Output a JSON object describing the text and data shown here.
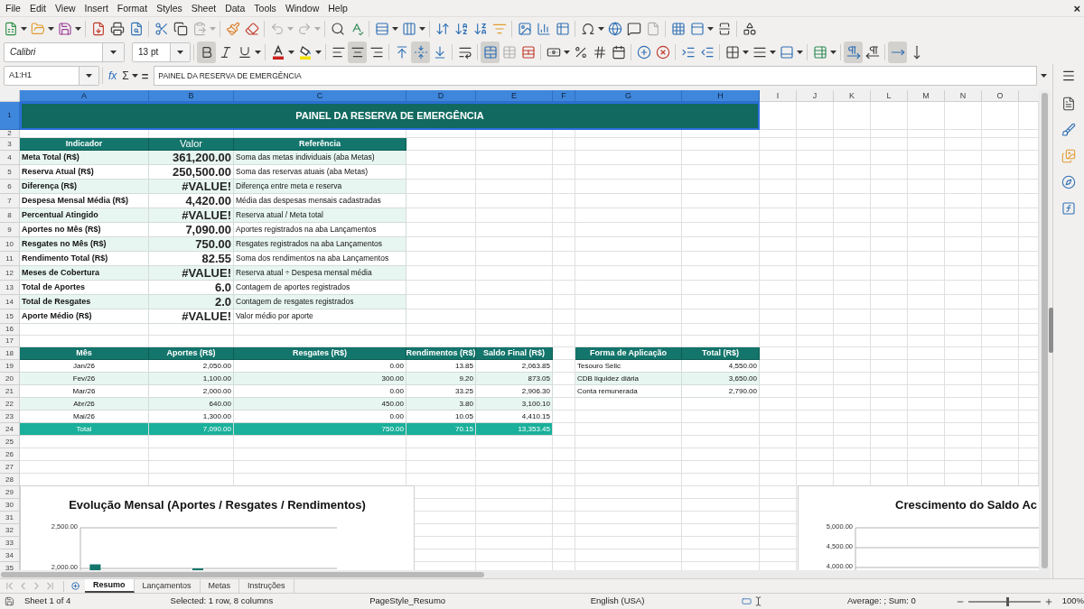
{
  "menu_bar": {
    "items": [
      "File",
      "Edit",
      "View",
      "Insert",
      "Format",
      "Styles",
      "Sheet",
      "Data",
      "Tools",
      "Window",
      "Help"
    ],
    "close": "×"
  },
  "standard_toolbar": {
    "groups": [
      [
        {
          "dropdown": true,
          "disabled": false
        },
        {
          "dropdown": true,
          "disabled": false
        },
        {
          "dropdown": true,
          "disabled": false
        }
      ],
      [
        {
          "dropdown": false,
          "disabled": false
        },
        {
          "dropdown": false,
          "disabled": false
        },
        {
          "dropdown": false,
          "disabled": false
        }
      ],
      [
        {
          "dropdown": false,
          "disabled": false
        },
        {
          "dropdown": false,
          "disabled": false
        },
        {
          "dropdown": true,
          "disabled": true
        }
      ],
      [
        {
          "dropdown": false,
          "disabled": false
        },
        {
          "dropdown": false,
          "disabled": false
        }
      ],
      [
        {
          "dropdown": true,
          "disabled": true
        },
        {
          "dropdown": true,
          "disabled": true
        }
      ],
      [
        {
          "dropdown": false,
          "disabled": false
        },
        {
          "dropdown": false,
          "disabled": false
        }
      ],
      [
        {
          "dropdown": true,
          "disabled": false
        },
        {
          "dropdown": true,
          "disabled": false
        }
      ],
      [
        {
          "dropdown": false,
          "disabled": false
        },
        {
          "dropdown": false,
          "disabled": false
        },
        {
          "dropdown": false,
          "disabled": false
        },
        {
          "dropdown": false,
          "disabled": false
        }
      ],
      [
        {
          "dropdown": false,
          "disabled": false
        },
        {
          "dropdown": false,
          "disabled": false
        },
        {
          "dropdown": false,
          "disabled": false
        }
      ],
      [
        {
          "dropdown": true,
          "disabled": false
        },
        {
          "dropdown": false,
          "disabled": false
        },
        {
          "dropdown": false,
          "disabled": false
        },
        {
          "dropdown": false,
          "disabled": true
        }
      ],
      [
        {
          "dropdown": false,
          "disabled": false
        },
        {
          "dropdown": true,
          "disabled": false
        },
        {
          "dropdown": false,
          "disabled": false
        }
      ],
      [
        {
          "dropdown": false,
          "disabled": false
        }
      ]
    ]
  },
  "formatting_toolbar": {
    "font_name": {
      "value": "Calibri"
    },
    "font_size": {
      "value": "13 pt"
    },
    "groups": [
      [
        {
          "dropdown": false,
          "disabled": false,
          "active": true
        },
        {
          "dropdown": false,
          "disabled": false,
          "active": false
        },
        {
          "dropdown": true,
          "disabled": false,
          "active": false
        }
      ],
      [
        {
          "dropdown": true,
          "disabled": false,
          "active": false
        },
        {
          "dropdown": true,
          "disabled": false,
          "active": false
        }
      ],
      [
        {
          "dropdown": false,
          "disabled": false,
          "active": false
        },
        {
          "dropdown": false,
          "disabled": false,
          "active": true
        },
        {
          "dropdown": false,
          "disabled": false,
          "active": false
        }
      ],
      [
        {
          "dropdown": false,
          "disabled": false,
          "active": false
        },
        {
          "dropdown": false,
          "disabled": false,
          "active": true
        },
        {
          "dropdown": false,
          "disabled": false,
          "active": false
        }
      ],
      [
        {
          "dropdown": false,
          "disabled": false,
          "active": false
        }
      ],
      [
        {
          "dropdown": false,
          "disabled": false,
          "active": true
        },
        {
          "dropdown": false,
          "disabled": true,
          "active": false
        },
        {
          "dropdown": false,
          "disabled": false,
          "active": false
        }
      ],
      [
        {
          "dropdown": true,
          "disabled": false,
          "active": false
        },
        {
          "dropdown": false,
          "disabled": false,
          "active": false
        },
        {
          "dropdown": false,
          "disabled": false,
          "active": false
        },
        {
          "dropdown": false,
          "disabled": false,
          "active": false
        }
      ],
      [
        {
          "dropdown": false,
          "disabled": false,
          "active": false
        },
        {
          "dropdown": false,
          "disabled": false,
          "active": false
        }
      ],
      [
        {
          "dropdown": false,
          "disabled": false,
          "active": false
        },
        {
          "dropdown": false,
          "disabled": false,
          "active": false
        }
      ],
      [
        {
          "dropdown": true,
          "disabled": false,
          "active": false
        },
        {
          "dropdown": true,
          "disabled": false,
          "active": false
        },
        {
          "dropdown": true,
          "disabled": false,
          "active": false
        }
      ],
      [
        {
          "dropdown": true,
          "disabled": false,
          "active": false
        }
      ],
      [
        {
          "dropdown": false,
          "disabled": false,
          "active": true
        },
        {
          "dropdown": false,
          "disabled": false,
          "active": false
        }
      ],
      [
        {
          "dropdown": false,
          "disabled": false,
          "active": true
        },
        {
          "dropdown": false,
          "disabled": false,
          "active": false
        }
      ]
    ]
  },
  "formula_bar": {
    "name_box": {
      "value": "A1:H1"
    },
    "buttons": [
      {
        "label": "fx",
        "dropdown": false
      },
      {
        "label": "Σ",
        "dropdown": true
      },
      {
        "label": "=",
        "dropdown": false
      }
    ],
    "content": {
      "value": "PAINEL DA RESERVA DE EMERGÊNCIA"
    }
  },
  "sheet": {
    "columns": [
      {
        "label": "A",
        "selected": true
      },
      {
        "label": "B",
        "selected": true
      },
      {
        "label": "C",
        "selected": true
      },
      {
        "label": "D",
        "selected": true
      },
      {
        "label": "E",
        "selected": true
      },
      {
        "label": "F",
        "selected": true
      },
      {
        "label": "G",
        "selected": true
      },
      {
        "label": "H",
        "selected": true
      },
      {
        "label": "I",
        "selected": false
      },
      {
        "label": "J",
        "selected": false
      },
      {
        "label": "K",
        "selected": false
      },
      {
        "label": "L",
        "selected": false
      },
      {
        "label": "M",
        "selected": false
      },
      {
        "label": "N",
        "selected": false
      },
      {
        "label": "O",
        "selected": false
      }
    ],
    "rows": [
      {
        "label": "1",
        "selected": true
      },
      {
        "label": "2",
        "selected": false
      },
      {
        "label": "3",
        "selected": false
      },
      {
        "label": "4",
        "selected": false
      },
      {
        "label": "5",
        "selected": false
      },
      {
        "label": "6",
        "selected": false
      },
      {
        "label": "7",
        "selected": false
      },
      {
        "label": "8",
        "selected": false
      },
      {
        "label": "9",
        "selected": false
      },
      {
        "label": "10",
        "selected": false
      },
      {
        "label": "11",
        "selected": false
      },
      {
        "label": "12",
        "selected": false
      },
      {
        "label": "13",
        "selected": false
      },
      {
        "label": "14",
        "selected": false
      },
      {
        "label": "15",
        "selected": false
      },
      {
        "label": "16",
        "selected": false
      },
      {
        "label": "17",
        "selected": false
      },
      {
        "label": "18",
        "selected": false
      },
      {
        "label": "19",
        "selected": false
      },
      {
        "label": "20",
        "selected": false
      },
      {
        "label": "21",
        "selected": false
      },
      {
        "label": "22",
        "selected": false
      },
      {
        "label": "23",
        "selected": false
      },
      {
        "label": "24",
        "selected": false
      },
      {
        "label": "25",
        "selected": false
      },
      {
        "label": "26",
        "selected": false
      },
      {
        "label": "27",
        "selected": false
      },
      {
        "label": "28",
        "selected": false
      },
      {
        "label": "29",
        "selected": false
      },
      {
        "label": "30",
        "selected": false
      },
      {
        "label": "31",
        "selected": false
      },
      {
        "label": "32",
        "selected": false
      },
      {
        "label": "33",
        "selected": false
      },
      {
        "label": "34",
        "selected": false
      },
      {
        "label": "35",
        "selected": false
      }
    ],
    "title_banner": {
      "text": "PAINEL DA RESERVA DE EMERGÊNCIA"
    },
    "indicators_table": {
      "columns": [
        "Indicador",
        "Valor",
        "Referência"
      ],
      "rows": [
        [
          "Meta Total (R$)",
          "361,200.00",
          "Soma das metas individuais (aba Metas)"
        ],
        [
          "Reserva Atual (R$)",
          "250,500.00",
          "Soma das reservas atuais (aba Metas)"
        ],
        [
          "Diferença (R$)",
          "#VALUE!",
          "Diferença entre meta e reserva"
        ],
        [
          "Despesa Mensal Média (R$)",
          "4,420.00",
          "Média das despesas mensais cadastradas"
        ],
        [
          "Percentual Atingido",
          "#VALUE!",
          "Reserva atual / Meta total"
        ],
        [
          "Aportes no Mês (R$)",
          "7,090.00",
          "Aportes registrados na aba Lançamentos"
        ],
        [
          "Resgates no Mês (R$)",
          "750.00",
          "Resgates registrados na aba Lançamentos"
        ],
        [
          "Rendimento Total (R$)",
          "82.55",
          "Soma dos rendimentos na aba Lançamentos"
        ],
        [
          "Meses de Cobertura",
          "#VALUE!",
          "Reserva atual ÷ Despesa mensal média"
        ],
        [
          "Total de Aportes",
          "6.0",
          "Contagem de aportes registrados"
        ],
        [
          "Total de Resgates",
          "2.0",
          "Contagem de resgates registrados"
        ],
        [
          "Aporte Médio (R$)",
          "#VALUE!",
          "Valor médio por aporte"
        ]
      ]
    },
    "monthly_table": {
      "columns": [
        "Mês",
        "Aportes (R$)",
        "Resgates (R$)",
        "Rendimentos (R$)",
        "Saldo Final (R$)"
      ],
      "rows": [
        [
          "Jan/26",
          "2,050.00",
          "0.00",
          "13.85",
          "2,063.85"
        ],
        [
          "Fev/26",
          "1,100.00",
          "300.00",
          "9.20",
          "873.05"
        ],
        [
          "Mar/26",
          "2,000.00",
          "0.00",
          "33.25",
          "2,906.30"
        ],
        [
          "Abr/26",
          "640.00",
          "450.00",
          "3.80",
          "3,100.10"
        ],
        [
          "Mai/26",
          "1,300.00",
          "0.00",
          "10.05",
          "4,410.15"
        ]
      ],
      "total": [
        "Total",
        "7,090.00",
        "750.00",
        "70.15",
        "13,353.45"
      ]
    },
    "allocation_table": {
      "columns": [
        "Forma de Aplicação",
        "Total (R$)"
      ],
      "rows": [
        [
          "Tesouro Selic",
          "4,550.00"
        ],
        [
          "CDB liquidez diária",
          "3,650.00"
        ],
        [
          "Conta remunerada",
          "2,790.00"
        ]
      ]
    },
    "charts": [
      {
        "kind": "chart",
        "chart_data": {
          "type": "bar",
          "title": "Evolução Mensal (Aportes / Resgates / Rendimentos)",
          "ylim": [
            1967,
            2500
          ],
          "yticks": [
            {
              "value": 2000,
              "label": "2,000.00"
            },
            {
              "value": 2500,
              "label": "2,500.00"
            }
          ],
          "series": [
            {
              "color": "#13756b",
              "values": [
                2050,
                null,
                2000,
                null,
                null
              ]
            }
          ]
        }
      },
      {
        "kind": "chart_preview",
        "title": "Crescimento do Saldo Ac",
        "axis_labels": [
          "5,000.00",
          "4,500.00",
          "4,000.00"
        ]
      }
    ]
  },
  "sheet_tabs": {
    "nav_buttons": [
      {
        "disabled": true
      },
      {
        "disabled": true
      },
      {
        "disabled": true
      },
      {
        "disabled": true
      }
    ],
    "tabs": [
      {
        "label": "Resumo",
        "selected": true
      },
      {
        "label": "Lançamentos",
        "selected": false
      },
      {
        "label": "Metas",
        "selected": false
      },
      {
        "label": "Instruções",
        "selected": false
      }
    ]
  },
  "status_bar": {
    "sheet_position": "Sheet 1 of 4",
    "selection": "Selected: 1 row, 8 columns",
    "page_style": "PageStyle_Resumo",
    "language": "English (USA)",
    "summary": "Average: ; Sum: 0",
    "zoom": {
      "level": 0.55,
      "reading": "100%"
    }
  }
}
